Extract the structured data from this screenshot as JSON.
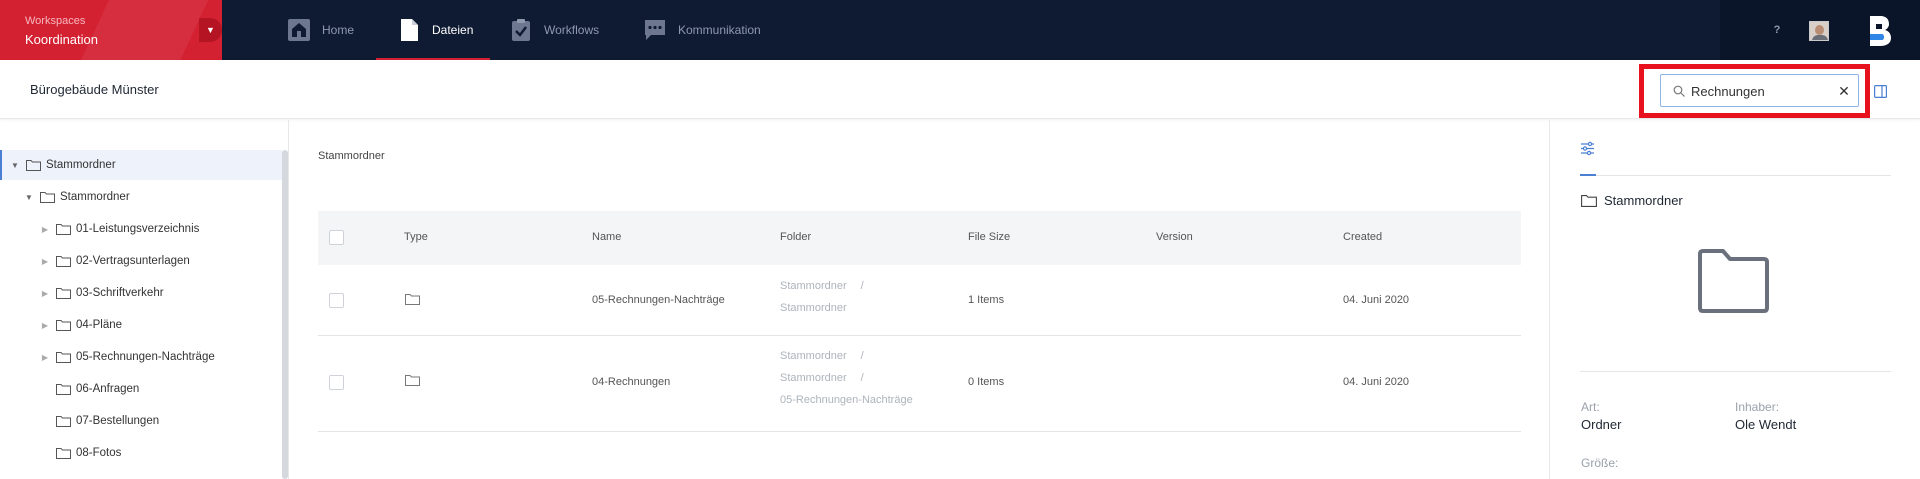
{
  "app": {
    "workspace_label": "Workspaces",
    "workspace_name": "Koordination"
  },
  "nav": {
    "items": [
      {
        "label": "Home",
        "icon": "home-icon"
      },
      {
        "label": "Dateien",
        "icon": "file-icon",
        "active": true
      },
      {
        "label": "Workflows",
        "icon": "clipboard-check-icon"
      },
      {
        "label": "Kommunikation",
        "icon": "chat-icon"
      }
    ],
    "help": "?"
  },
  "header": {
    "project_title": "Bürogebäude Münster"
  },
  "search": {
    "value": "Rechnungen",
    "clear_glyph": "✕"
  },
  "tree": {
    "items": [
      {
        "label": "Stammordner",
        "expanded": true,
        "selected": true
      },
      {
        "label": "Stammordner",
        "expanded": true
      },
      {
        "label": "01-Leistungsverzeichnis"
      },
      {
        "label": "02-Vertragsunterlagen"
      },
      {
        "label": "03-Schriftverkehr"
      },
      {
        "label": "04-Pläne"
      },
      {
        "label": "05-Rechnungen-Nachträge"
      },
      {
        "label": "06-Anfragen"
      },
      {
        "label": "07-Bestellungen"
      },
      {
        "label": "08-Fotos"
      }
    ]
  },
  "main": {
    "breadcrumb": "Stammordner",
    "columns": [
      "Type",
      "Name",
      "Folder",
      "File Size",
      "Version",
      "Created"
    ],
    "rows": [
      {
        "type": "folder",
        "name": "05-Rechnungen-Nachträge",
        "folder": [
          "Stammordner",
          "Stammordner"
        ],
        "size": "1 Items",
        "version": "",
        "created": "04. Juni 2020"
      },
      {
        "type": "folder",
        "name": "04-Rechnungen",
        "folder": [
          "Stammordner",
          "Stammordner",
          "05-Rechnungen-Nachträge"
        ],
        "size": "0 Items",
        "version": "",
        "created": "04. Juni 2020"
      }
    ],
    "path_separator": "/"
  },
  "details": {
    "name": "Stammordner",
    "art_label": "Art:",
    "art_value": "Ordner",
    "owner_label": "Inhaber:",
    "owner_value": "Ole Wendt",
    "size_label": "Größe:"
  },
  "colors": {
    "brand_red": "#d42132",
    "nav_bg": "#0f1b33",
    "accent_blue": "#4a7fd4",
    "highlight": "#e8121f"
  }
}
